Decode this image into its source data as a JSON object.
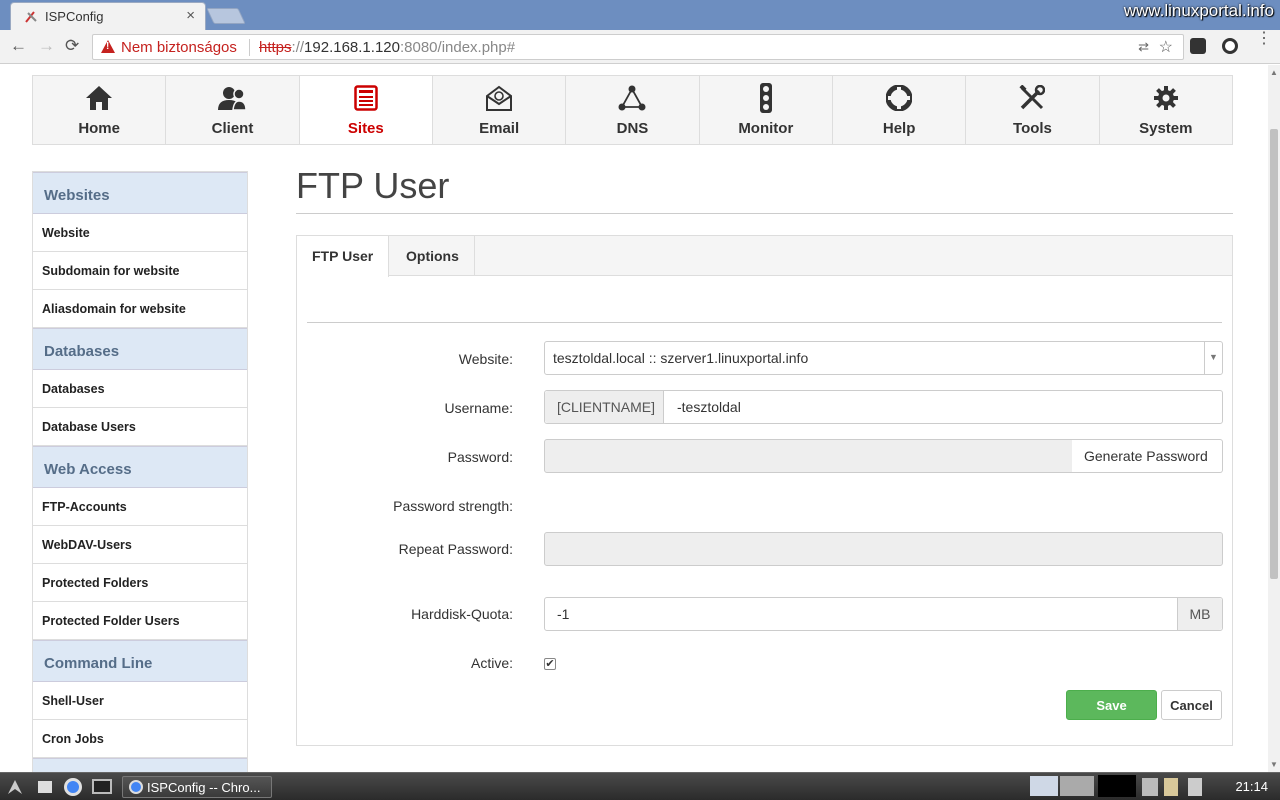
{
  "browser": {
    "tab_title": "ISPConfig",
    "tab_close": "×",
    "watermark": "www.linuxportal.info",
    "security_label": "Nem biztonságos",
    "url_scheme": "https",
    "url_sep": "://",
    "url_host": "192.168.1.120",
    "url_rest": ":8080/index.php#",
    "back": "←",
    "forward": "→",
    "reload": "⟳",
    "star": "☆",
    "translate": "⇄",
    "menu": "⋮"
  },
  "mainnav": {
    "items": [
      {
        "label": "Home",
        "icon": "home-icon"
      },
      {
        "label": "Client",
        "icon": "client-icon"
      },
      {
        "label": "Sites",
        "icon": "sites-icon"
      },
      {
        "label": "Email",
        "icon": "email-icon"
      },
      {
        "label": "DNS",
        "icon": "dns-icon"
      },
      {
        "label": "Monitor",
        "icon": "monitor-icon"
      },
      {
        "label": "Help",
        "icon": "help-icon"
      },
      {
        "label": "Tools",
        "icon": "tools-icon"
      },
      {
        "label": "System",
        "icon": "system-icon"
      }
    ],
    "active": "Sites"
  },
  "sidebar": {
    "sections": [
      {
        "title": "Websites",
        "items": [
          "Website",
          "Subdomain for website",
          "Aliasdomain for website"
        ]
      },
      {
        "title": "Databases",
        "items": [
          "Databases",
          "Database Users"
        ]
      },
      {
        "title": "Web Access",
        "items": [
          "FTP-Accounts",
          "WebDAV-Users",
          "Protected Folders",
          "Protected Folder Users"
        ]
      },
      {
        "title": "Command Line",
        "items": [
          "Shell-User",
          "Cron Jobs"
        ]
      }
    ]
  },
  "page": {
    "title": "FTP User",
    "tabs": [
      "FTP User",
      "Options"
    ],
    "form": {
      "website_label": "Website:",
      "website_value": "tesztoldal.local :: szerver1.linuxportal.info",
      "username_label": "Username:",
      "username_prefix": "[CLIENTNAME]",
      "username_value": "-tesztoldal",
      "password_label": "Password:",
      "generate_password": "Generate Password",
      "strength_label": "Password strength:",
      "repeat_label": "Repeat Password:",
      "quota_label": "Harddisk-Quota:",
      "quota_value": "-1",
      "quota_unit": "MB",
      "active_label": "Active:",
      "active_checked": true,
      "checkmark": "✔",
      "save": "Save",
      "cancel": "Cancel"
    }
  },
  "taskbar": {
    "window_title": "ISPConfig -- Chro...",
    "clock": "21:14"
  },
  "colors": {
    "active_nav": "#cc0000",
    "sidebar_head_bg": "#dde8f5",
    "save_green": "#5cb85c",
    "insecure_red": "#c5221f"
  }
}
